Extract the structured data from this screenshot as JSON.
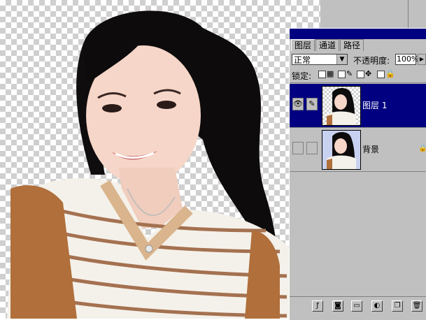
{
  "canvas": {
    "subject": "photo-cutout-portrait"
  },
  "panel": {
    "tabs": [
      "图层",
      "通道",
      "路径"
    ],
    "blend_mode": "正常",
    "opacity_label": "不透明度:",
    "opacity_value": "100%",
    "lock_label": "锁定:",
    "layers": [
      {
        "name": "图层 1",
        "selected": true,
        "visible": true,
        "locked": false
      },
      {
        "name": "背景",
        "selected": false,
        "visible": false,
        "locked": true
      }
    ],
    "bottom_buttons": [
      "layer-style-icon",
      "mask-icon",
      "new-set-icon",
      "adjustment-icon",
      "new-layer-icon",
      "trash-icon"
    ]
  },
  "colors": {
    "selection": "#000080",
    "panel_bg": "#c0c0c0"
  }
}
